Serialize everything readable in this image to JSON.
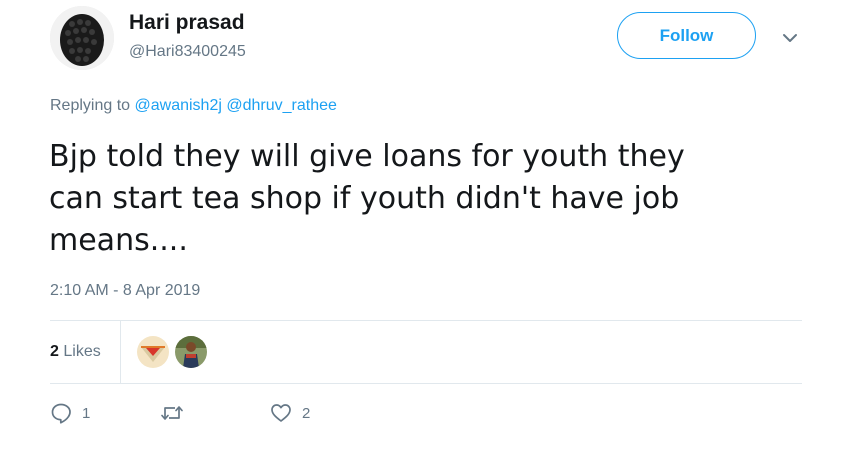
{
  "user": {
    "name": "Hari prasad",
    "handle": "@Hari83400245"
  },
  "header": {
    "follow_label": "Follow"
  },
  "reply": {
    "prefix": "Replying to",
    "mentions": [
      "@awanish2j",
      "@dhruv_rathee"
    ]
  },
  "tweet": {
    "text": "Bjp told they will give loans for youth they\ncan start tea shop if youth didn't have job\nmeans....",
    "timestamp": "2:10 AM - 8 Apr 2019"
  },
  "stats": {
    "likes_count": "2",
    "likes_label": "Likes"
  },
  "actions": {
    "reply_count": "1",
    "retweet_count": "",
    "like_count": "2"
  },
  "colors": {
    "accent": "#1da1f2",
    "muted": "#657786",
    "divider": "#e1e8ed"
  },
  "icons": [
    "avatar",
    "chevron-down-icon",
    "reply-icon",
    "retweet-icon",
    "heart-icon"
  ]
}
